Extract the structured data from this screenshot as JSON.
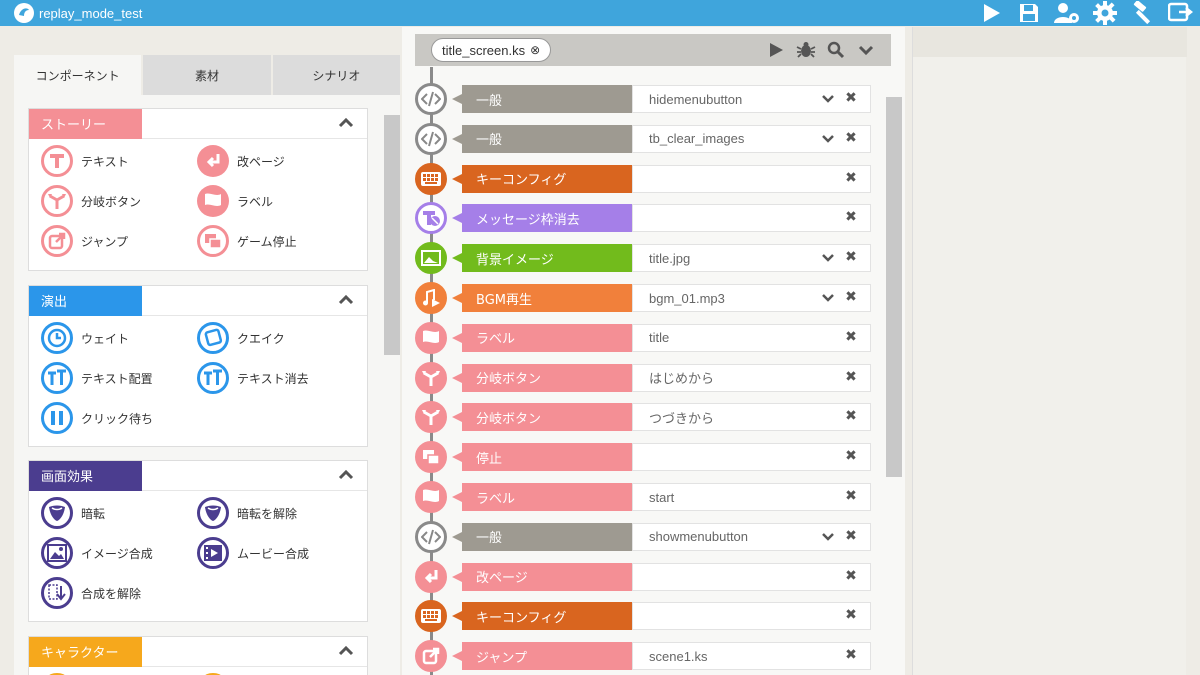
{
  "app": {
    "title": "replay_mode_test"
  },
  "toolbar_icons": [
    "play-icon",
    "save-icon",
    "user-settings-icon",
    "gear-icon",
    "hammer-icon",
    "export-icon"
  ],
  "tabs": [
    {
      "label": "コンポーネント",
      "active": true
    },
    {
      "label": "素材",
      "active": false
    },
    {
      "label": "シナリオ",
      "active": false
    }
  ],
  "groups": [
    {
      "title": "ストーリー",
      "color": "#f48f95",
      "items": [
        {
          "label": "テキスト",
          "icon": "text-t-icon"
        },
        {
          "label": "改ページ",
          "icon": "page-return-icon"
        },
        {
          "label": "分岐ボタン",
          "icon": "branch-icon"
        },
        {
          "label": "ラベル",
          "icon": "flag-icon"
        },
        {
          "label": "ジャンプ",
          "icon": "jump-icon"
        },
        {
          "label": "ゲーム停止",
          "icon": "stop-icon"
        }
      ]
    },
    {
      "title": "演出",
      "color": "#2b96ea",
      "items": [
        {
          "label": "ウェイト",
          "icon": "clock-icon"
        },
        {
          "label": "クエイク",
          "icon": "quake-icon"
        },
        {
          "label": "テキスト配置",
          "icon": "text-place-icon"
        },
        {
          "label": "テキスト消去",
          "icon": "text-clear-icon"
        },
        {
          "label": "クリック待ち",
          "icon": "pause-icon"
        }
      ]
    },
    {
      "title": "画面効果",
      "color": "#4b3d8f",
      "items": [
        {
          "label": "暗転",
          "icon": "fade-out-icon"
        },
        {
          "label": "暗転を解除",
          "icon": "fade-in-icon"
        },
        {
          "label": "イメージ合成",
          "icon": "image-compose-icon"
        },
        {
          "label": "ムービー合成",
          "icon": "movie-compose-icon"
        },
        {
          "label": "合成を解除",
          "icon": "compose-clear-icon"
        }
      ]
    },
    {
      "title": "キャラクター",
      "color": "#f6a81c",
      "items": []
    }
  ],
  "scenario": {
    "file": "title_screen.ks",
    "tools": [
      "play-icon",
      "debug-bug-icon",
      "search-icon",
      "chevron-down-icon"
    ],
    "rows": [
      {
        "label": "一般",
        "value": "hidemenubutton",
        "color": "#9e9a91",
        "icon": "code-icon",
        "dropdown": true
      },
      {
        "label": "一般",
        "value": "tb_clear_images",
        "color": "#9e9a91",
        "icon": "code-icon",
        "dropdown": true
      },
      {
        "label": "キーコンフィグ",
        "value": "",
        "color": "#d9651f",
        "icon": "keyboard-icon",
        "dropdown": false
      },
      {
        "label": "メッセージ枠消去",
        "value": "",
        "color": "#a57fe8",
        "icon": "message-clear-icon",
        "dropdown": false
      },
      {
        "label": "背景イメージ",
        "value": "title.jpg",
        "color": "#72bb1c",
        "icon": "background-image-icon",
        "dropdown": true
      },
      {
        "label": "BGM再生",
        "value": "bgm_01.mp3",
        "color": "#f1803b",
        "icon": "music-play-icon",
        "dropdown": true
      },
      {
        "label": "ラベル",
        "value": "title",
        "color": "#f48f95",
        "icon": "flag-icon",
        "dropdown": false
      },
      {
        "label": "分岐ボタン",
        "value": "はじめから",
        "color": "#f48f95",
        "icon": "branch-icon",
        "dropdown": false
      },
      {
        "label": "分岐ボタン",
        "value": "つづきから",
        "color": "#f48f95",
        "icon": "branch-icon",
        "dropdown": false
      },
      {
        "label": "停止",
        "value": "",
        "color": "#f48f95",
        "icon": "stop-icon",
        "dropdown": false
      },
      {
        "label": "ラベル",
        "value": "start",
        "color": "#f48f95",
        "icon": "flag-icon",
        "dropdown": false
      },
      {
        "label": "一般",
        "value": "showmenubutton",
        "color": "#9e9a91",
        "icon": "code-icon",
        "dropdown": true
      },
      {
        "label": "改ページ",
        "value": "",
        "color": "#f48f95",
        "icon": "page-return-icon",
        "dropdown": false
      },
      {
        "label": "キーコンフィグ",
        "value": "",
        "color": "#d9651f",
        "icon": "keyboard-icon",
        "dropdown": false
      },
      {
        "label": "ジャンプ",
        "value": "scene1.ks",
        "color": "#f48f95",
        "icon": "jump-icon",
        "dropdown": false
      }
    ]
  }
}
